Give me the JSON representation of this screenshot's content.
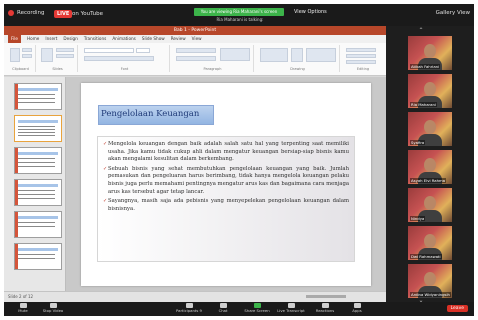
{
  "topbar": {
    "recording": "Recording",
    "live_badge": "LIVE",
    "live_platform": "on YouTube",
    "share_banner": "You are viewing Ria Maharani's screen",
    "share_sub": "Ria Maharani is talking:",
    "view_options": "View Options",
    "view_mode": "Gallery View"
  },
  "ppt": {
    "title": "Bab 1 - PowerPoint",
    "tabs": [
      "File",
      "Home",
      "Insert",
      "Design",
      "Transitions",
      "Animations",
      "Slide Show",
      "Review",
      "View"
    ],
    "groups": [
      "Clipboard",
      "Slides",
      "Font",
      "Paragraph",
      "Drawing",
      "Editing"
    ],
    "status_slide": "Slide 2 of 12"
  },
  "slide": {
    "title": "Pengelolaan Keuangan",
    "bullets": [
      "Mengelola keuangan dengan baik adalah salah satu hal yang terpenting saat memiliki usaha. Jika kamu tidak cukup ahli dalam mengatur keuangan bersiap-siap bisnis kamu akan mengalami kesulitan dalam berkembang.",
      "Sebuah bisnis yang sehat membutuhkan pengelolaan keuangan yang baik. Jumlah pemasukan dan pengeluaran harus berimbang, tidak hanya mengelola keuangan pelaku bisnis juga perlu memahami pentingnya mengatur arus kas dan bagaimana cara menjaga arus kas tersebut agar tetap lancar.",
      "Sayangnya, masih saja ada pebisnis yang menyepelekan pengelolaan keuangan dalam bisnisnya."
    ]
  },
  "participants": [
    {
      "name": "Atikah Fahriani"
    },
    {
      "name": "Ria Maharani"
    },
    {
      "name": "Syafira"
    },
    {
      "name": "Asyah Elvi Rahma"
    },
    {
      "name": "Nindya"
    },
    {
      "name": "Dwi Rahmawati"
    },
    {
      "name": "Ardina Widyaningsih"
    }
  ],
  "toolbar": {
    "mute": "Mute",
    "stop_video": "Stop Video",
    "participants": "Participants",
    "participants_count": "9",
    "chat": "Chat",
    "share_screen": "Share Screen",
    "live_transcript": "Live Transcript",
    "reactions": "Reactions",
    "apps": "Apps",
    "leave": "Leave"
  }
}
